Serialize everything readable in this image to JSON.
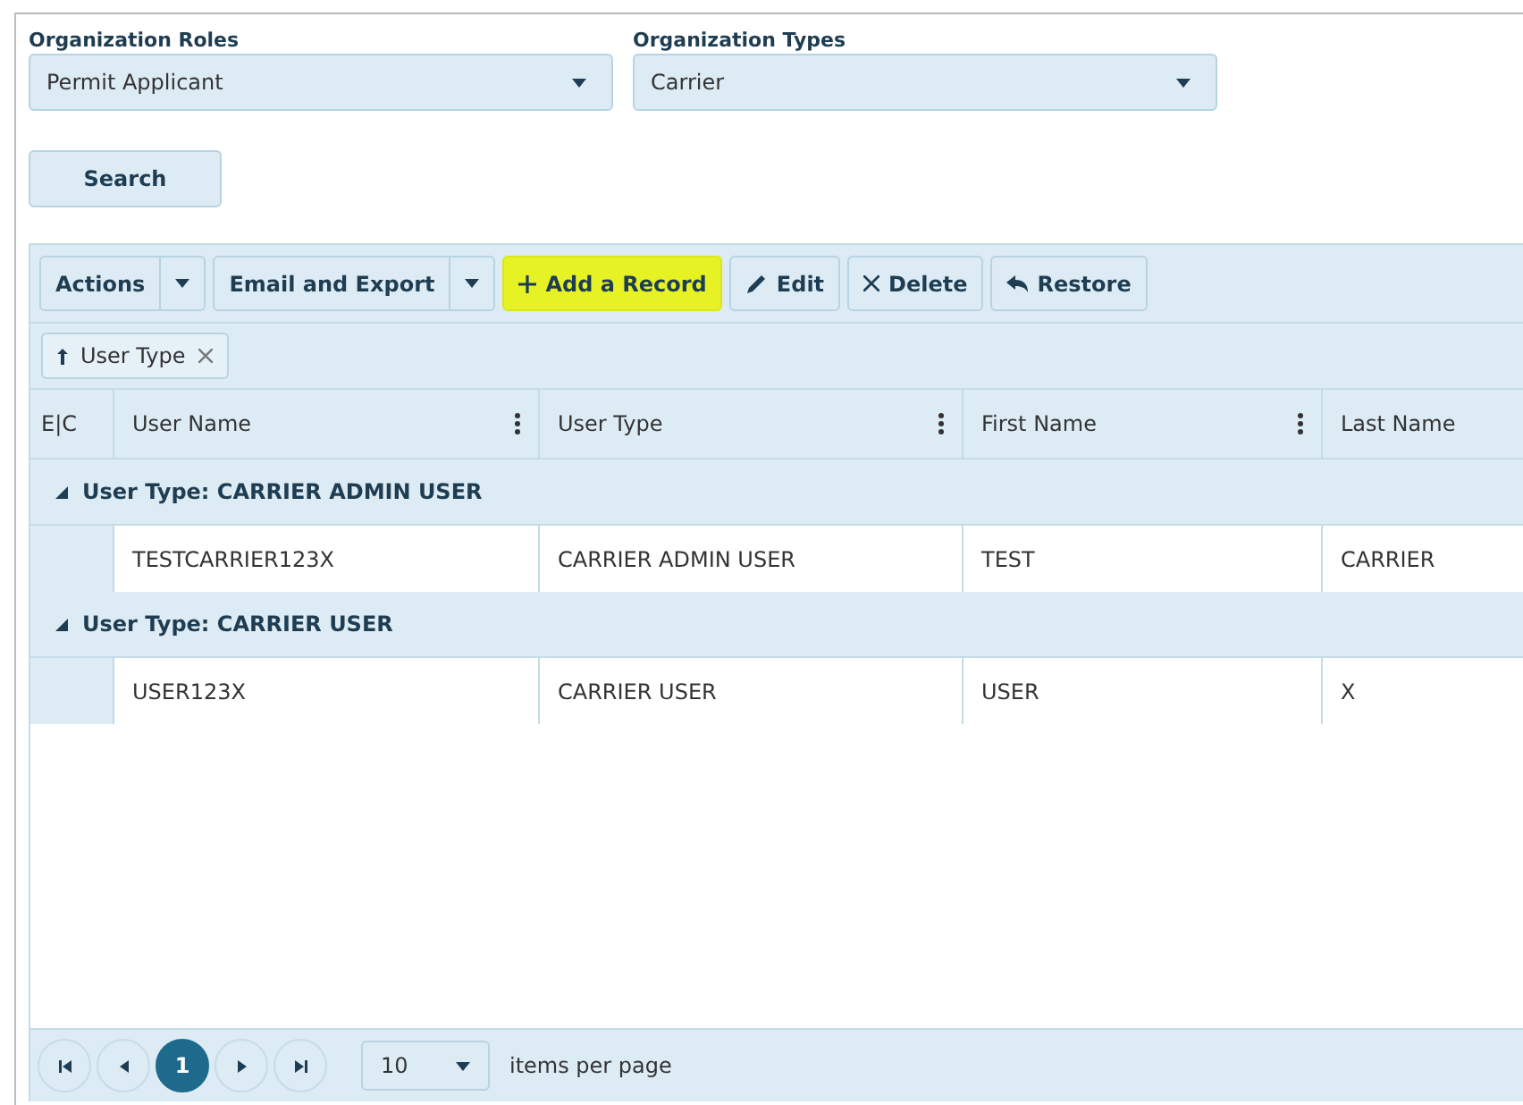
{
  "filters": [
    {
      "label": "Organization Roles",
      "value": "Permit Applicant"
    },
    {
      "label": "Organization Types",
      "value": "Carrier"
    }
  ],
  "search_button": "Search",
  "toolbar": [
    {
      "kind": "split",
      "label": "Actions",
      "highlighted": false
    },
    {
      "kind": "split",
      "label": "Email and Export",
      "highlighted": false
    },
    {
      "kind": "add",
      "label": "Add a Record",
      "highlighted": true
    },
    {
      "kind": "edit",
      "label": "Edit",
      "highlighted": false
    },
    {
      "kind": "delete",
      "label": "Delete",
      "highlighted": false
    },
    {
      "kind": "restore",
      "label": "Restore",
      "highlighted": false
    }
  ],
  "group_chips": [
    {
      "label": "User Type"
    }
  ],
  "table": {
    "expand_collapse_header": "E|C",
    "columns": [
      {
        "label": "User Name",
        "menu": true
      },
      {
        "label": "User Type",
        "menu": true
      },
      {
        "label": "First Name",
        "menu": true
      },
      {
        "label": "Last Name",
        "menu": false
      }
    ],
    "groups": [
      {
        "title": "User Type: CARRIER ADMIN USER",
        "expanded": true,
        "rows": [
          [
            "TESTCARRIER123X",
            "CARRIER ADMIN USER",
            "TEST",
            "CARRIER"
          ]
        ]
      },
      {
        "title": "User Type: CARRIER USER",
        "expanded": true,
        "rows": [
          [
            "USER123X",
            "CARRIER USER",
            "USER",
            "X"
          ]
        ]
      }
    ]
  },
  "pager": {
    "pages": [
      {
        "label": "1",
        "selected": true
      }
    ],
    "page_size": "10",
    "page_size_label": "items per page"
  }
}
